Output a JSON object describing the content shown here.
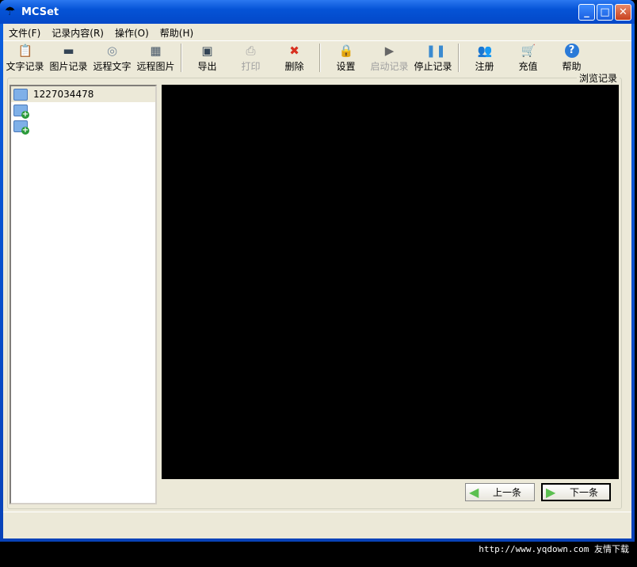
{
  "window": {
    "title": "MCSet"
  },
  "menu": [
    "文件(F)",
    "记录内容(R)",
    "操作(O)",
    "帮助(H)"
  ],
  "toolbar": [
    {
      "label": "文字记录",
      "icon": "text-record-icon",
      "disabled": false
    },
    {
      "label": "图片记录",
      "icon": "image-record-icon",
      "disabled": false
    },
    {
      "label": "远程文字",
      "icon": "remote-text-icon",
      "disabled": false
    },
    {
      "label": "远程图片",
      "icon": "remote-image-icon",
      "disabled": false
    },
    {
      "label": "导出",
      "icon": "save-icon",
      "disabled": false
    },
    {
      "label": "打印",
      "icon": "printer-icon",
      "disabled": true
    },
    {
      "label": "删除",
      "icon": "delete-icon",
      "disabled": false
    },
    {
      "label": "设置",
      "icon": "settings-icon",
      "disabled": false
    },
    {
      "label": "启动记录",
      "icon": "play-icon",
      "disabled": true
    },
    {
      "label": "停止记录",
      "icon": "pause-icon",
      "disabled": false
    },
    {
      "label": "注册",
      "icon": "users-icon",
      "disabled": false
    },
    {
      "label": "充值",
      "icon": "cart-icon",
      "disabled": false
    },
    {
      "label": "帮助",
      "icon": "help-icon",
      "disabled": false
    }
  ],
  "group_label": "浏览记录",
  "tree": {
    "root": "1227034478"
  },
  "nav": {
    "prev": "上一条",
    "next": "下一条"
  },
  "watermark": "http://www.yqdown.com 友情下载"
}
